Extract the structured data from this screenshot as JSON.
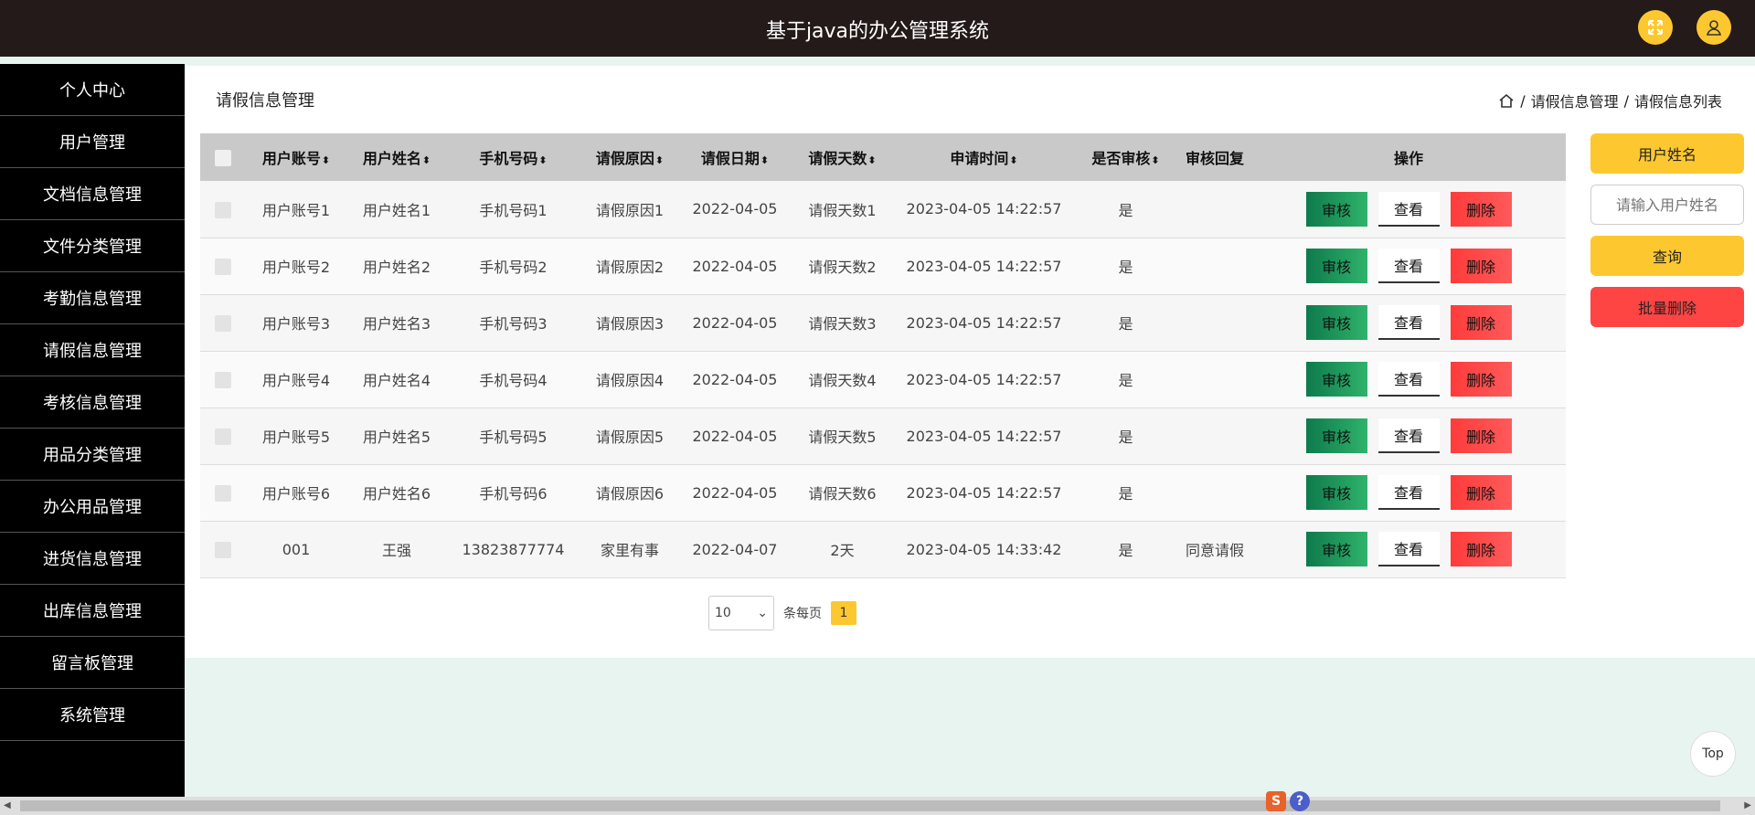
{
  "header": {
    "title": "基于java的办公管理系统"
  },
  "sidebar": {
    "items": [
      {
        "label": "个人中心"
      },
      {
        "label": "用户管理"
      },
      {
        "label": "文档信息管理"
      },
      {
        "label": "文件分类管理"
      },
      {
        "label": "考勤信息管理"
      },
      {
        "label": "请假信息管理"
      },
      {
        "label": "考核信息管理"
      },
      {
        "label": "用品分类管理"
      },
      {
        "label": "办公用品管理"
      },
      {
        "label": "进货信息管理"
      },
      {
        "label": "出库信息管理"
      },
      {
        "label": "留言板管理"
      },
      {
        "label": "系统管理"
      }
    ]
  },
  "main": {
    "title": "请假信息管理",
    "breadcrumb": [
      "请假信息管理",
      "请假信息列表"
    ]
  },
  "table": {
    "headers": [
      "用户账号",
      "用户姓名",
      "手机号码",
      "请假原因",
      "请假日期",
      "请假天数",
      "申请时间",
      "是否审核",
      "审核回复",
      "操作"
    ],
    "sort_glyph": "⬍",
    "rows": [
      [
        "用户账号1",
        "用户姓名1",
        "手机号码1",
        "请假原因1",
        "2022-04-05",
        "请假天数1",
        "2023-04-05 14:22:57",
        "是",
        ""
      ],
      [
        "用户账号2",
        "用户姓名2",
        "手机号码2",
        "请假原因2",
        "2022-04-05",
        "请假天数2",
        "2023-04-05 14:22:57",
        "是",
        ""
      ],
      [
        "用户账号3",
        "用户姓名3",
        "手机号码3",
        "请假原因3",
        "2022-04-05",
        "请假天数3",
        "2023-04-05 14:22:57",
        "是",
        ""
      ],
      [
        "用户账号4",
        "用户姓名4",
        "手机号码4",
        "请假原因4",
        "2022-04-05",
        "请假天数4",
        "2023-04-05 14:22:57",
        "是",
        ""
      ],
      [
        "用户账号5",
        "用户姓名5",
        "手机号码5",
        "请假原因5",
        "2022-04-05",
        "请假天数5",
        "2023-04-05 14:22:57",
        "是",
        ""
      ],
      [
        "用户账号6",
        "用户姓名6",
        "手机号码6",
        "请假原因6",
        "2022-04-05",
        "请假天数6",
        "2023-04-05 14:22:57",
        "是",
        ""
      ],
      [
        "001",
        "王强",
        "13823877774",
        "家里有事",
        "2022-04-07",
        "2天",
        "2023-04-05 14:33:42",
        "是",
        "同意请假"
      ]
    ],
    "actions": {
      "audit": "审核",
      "view": "查看",
      "delete": "删除"
    }
  },
  "pagination": {
    "page_size": "10",
    "per_page_label": "条每页",
    "current_page": "1"
  },
  "search": {
    "field_label": "用户姓名",
    "placeholder": "请输入用户姓名",
    "query_label": "查询",
    "batch_delete_label": "批量删除"
  },
  "top_button": {
    "label": "Top"
  },
  "colors": {
    "header_bg": "#241a1a",
    "accent_yellow": "#fdc82f",
    "danger_red": "#ff4444",
    "audit_green": "#1a9a5e",
    "page_bg": "#e8f4ef"
  }
}
